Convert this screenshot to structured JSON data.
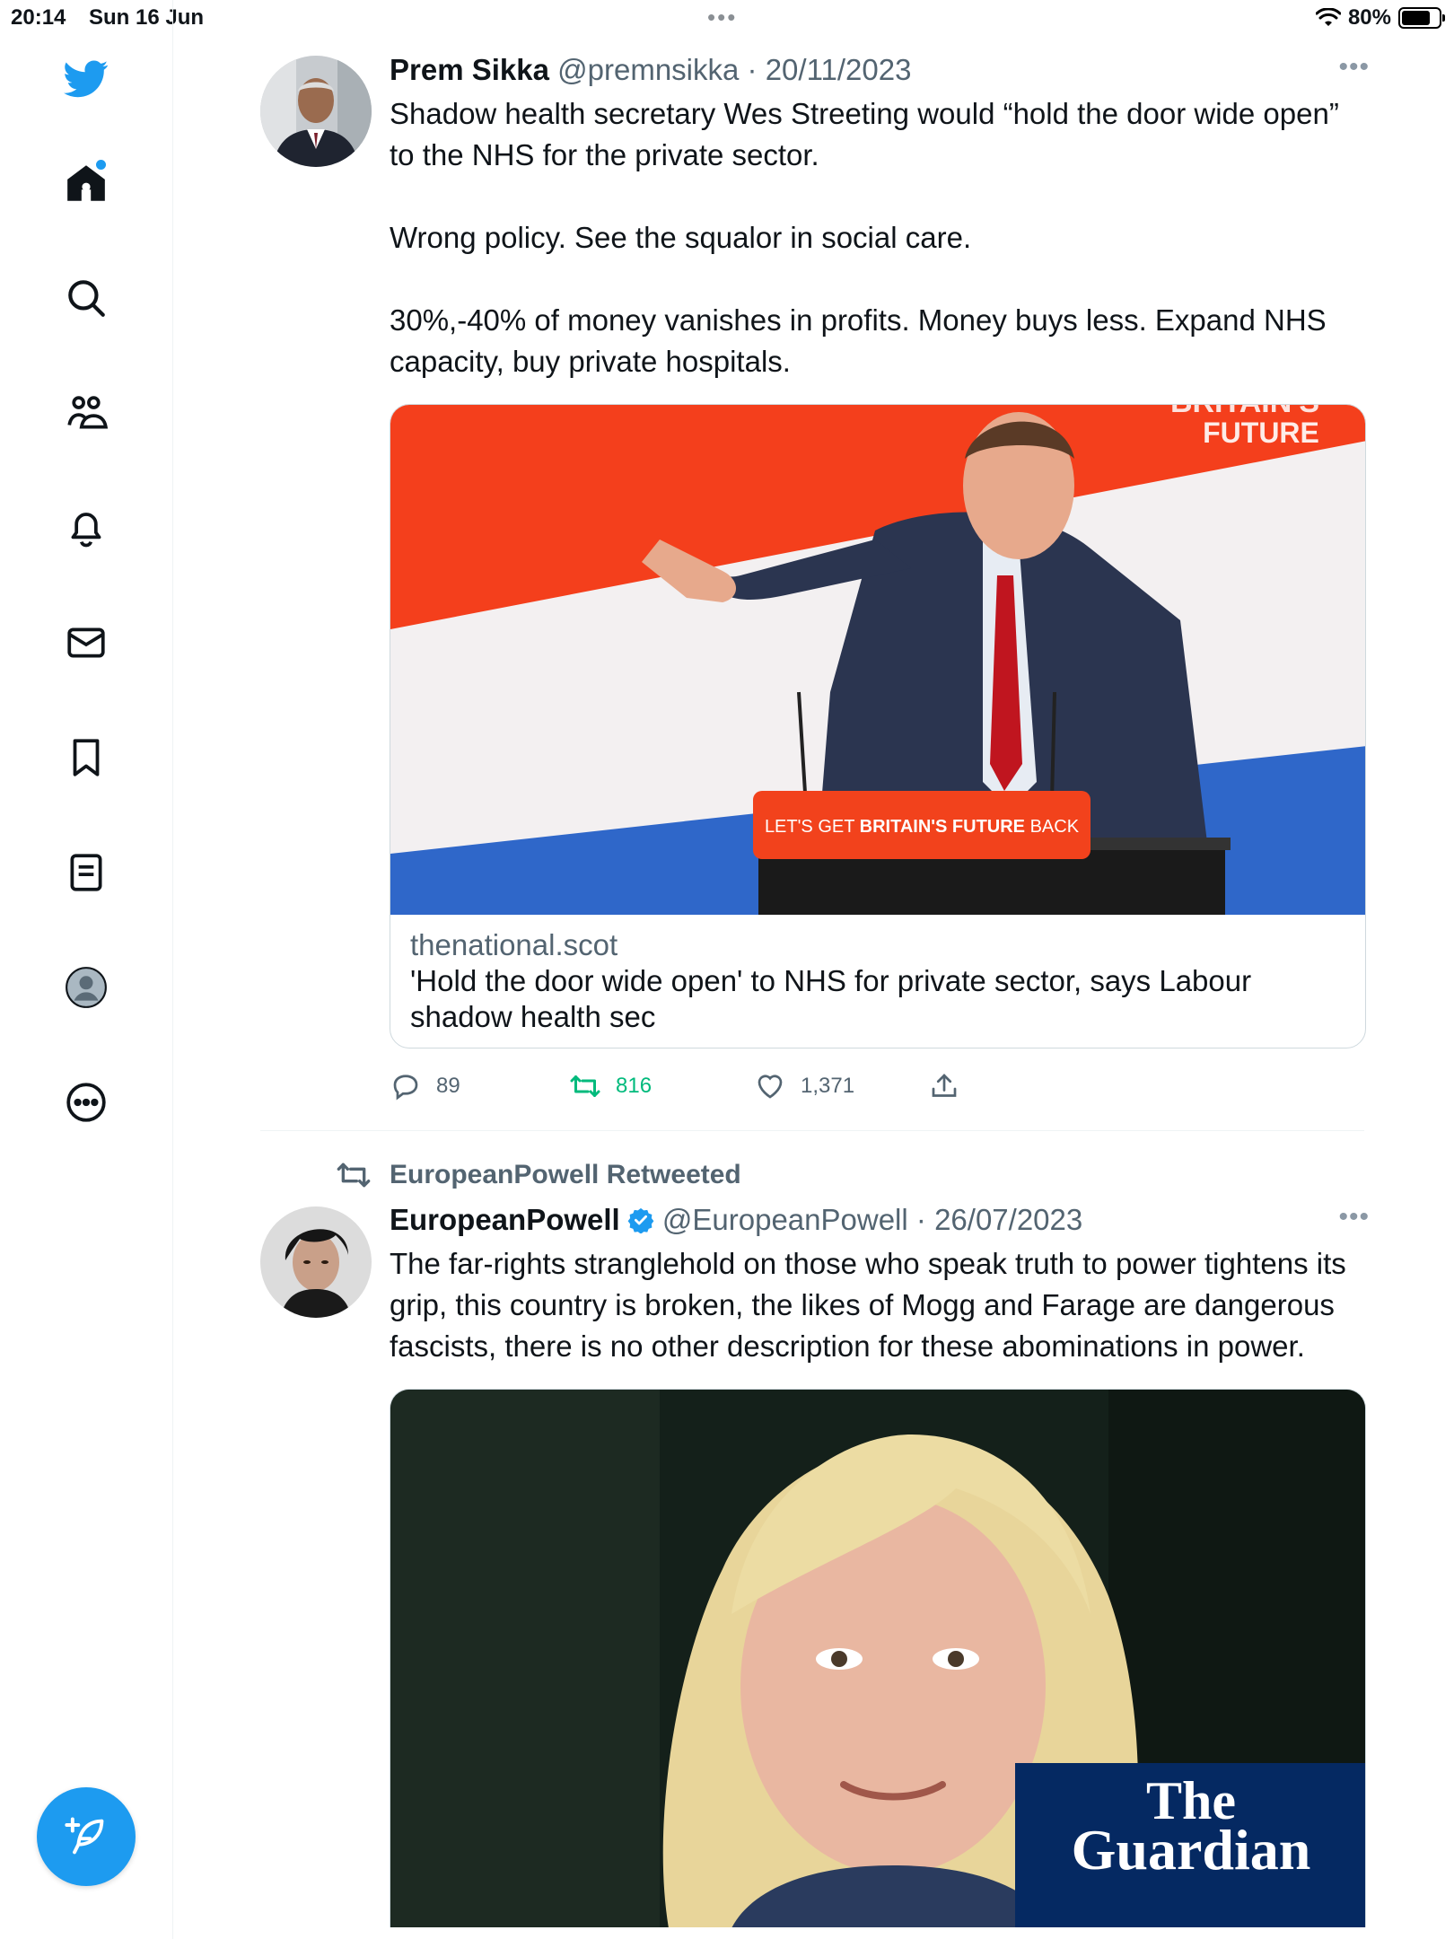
{
  "status_bar": {
    "time": "20:14",
    "date": "Sun 16 Jun",
    "battery": "80%",
    "battery_level": 0.8
  },
  "sidebar": {
    "items": [
      {
        "icon": "twitter-bird-icon",
        "label": "Twitter"
      },
      {
        "icon": "home-icon",
        "label": "Home"
      },
      {
        "icon": "search-icon",
        "label": "Explore"
      },
      {
        "icon": "communities-icon",
        "label": "Communities"
      },
      {
        "icon": "notifications-bell-icon",
        "label": "Notifications"
      },
      {
        "icon": "messages-mail-icon",
        "label": "Messages"
      },
      {
        "icon": "bookmark-icon",
        "label": "Bookmarks"
      },
      {
        "icon": "lists-icon",
        "label": "Lists"
      },
      {
        "icon": "profile-avatar-icon",
        "label": "Profile"
      },
      {
        "icon": "more-circle-icon",
        "label": "More"
      }
    ],
    "compose_icon": "compose-feather-icon"
  },
  "tweets": [
    {
      "name": "Prem Sikka",
      "handle": "@premnsikka",
      "date": "· 20/11/2023",
      "text": "Shadow health secretary Wes Streeting would “hold the door wide open” to the NHS for the private sector.\n\nWrong policy. See the squalor in social care.\n\n30%,-40% of money vanishes in profits. Money buys less. Expand NHS capacity, buy private hospitals.",
      "image": {
        "backdrop_top": "BRITAIN'S",
        "backdrop_bottom": "FUTURE",
        "podium_pre": "LET'S GET ",
        "podium_bold": "BRITAIN'S FUTURE",
        "podium_post": " BACK"
      },
      "card": {
        "domain": "thenational.scot",
        "title": "'Hold the door wide open' to NHS for private sector, says Labour shadow health sec"
      },
      "actions": {
        "replies": "89",
        "retweets": "816",
        "likes": "1,371"
      }
    },
    {
      "retweeted_by": "EuropeanPowell Retweeted",
      "name": "EuropeanPowell",
      "handle": "@EuropeanPowell",
      "date": "· 26/07/2023",
      "verified": true,
      "text": "The far-rights stranglehold on those who speak truth to power tightens its grip, this country is broken, the likes of Mogg and Farage are dangerous fascists, there is no other description for these abominations in power.",
      "image": {
        "logo_line1": "The",
        "logo_line2": "Guardian"
      }
    }
  ],
  "colors": {
    "accent": "#1d9bf0",
    "retweet_green": "#00ba7c",
    "muted_text": "#536471",
    "border": "#cfd9de"
  }
}
